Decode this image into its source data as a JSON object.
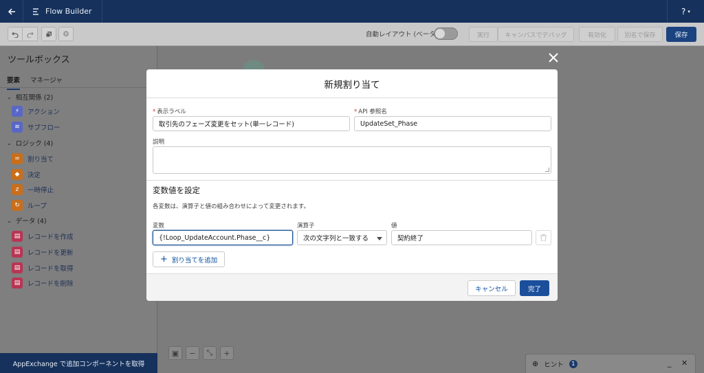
{
  "app": {
    "title": "Flow Builder",
    "help_label": "?"
  },
  "toolbar": {
    "auto_layout_label": "自動レイアウト (ベータ)",
    "auto_layout_on": false,
    "run_label": "実行",
    "debug_label": "キャンバスでデバッグ",
    "activate_label": "有効化",
    "save_as_label": "別名で保存",
    "save_label": "保存"
  },
  "toolbox": {
    "title": "ツールボックス",
    "tabs": [
      {
        "label": "要素"
      },
      {
        "label": "マネージャ"
      }
    ],
    "sections": [
      {
        "label": "相互関係 (2)",
        "items": [
          {
            "label": "アクション",
            "icon": "lightning-icon",
            "color": "#5867c6"
          },
          {
            "label": "サブフロー",
            "icon": "flow-icon",
            "color": "#5867c6"
          }
        ]
      },
      {
        "label": "ロジック (4)",
        "items": [
          {
            "label": "割り当て",
            "icon": "assignment-icon",
            "color": "#c96e1b"
          },
          {
            "label": "決定",
            "icon": "decision-icon",
            "color": "#c96e1b"
          },
          {
            "label": "一時停止",
            "icon": "pause-icon",
            "color": "#c96e1b"
          },
          {
            "label": "ループ",
            "icon": "loop-icon",
            "color": "#c96e1b"
          }
        ]
      },
      {
        "label": "データ (4)",
        "items": [
          {
            "label": "レコードを作成",
            "icon": "record-create-icon",
            "color": "#b83554"
          },
          {
            "label": "レコードを更新",
            "icon": "record-update-icon",
            "color": "#b83554"
          },
          {
            "label": "レコードを取得",
            "icon": "record-lookup-icon",
            "color": "#b83554"
          },
          {
            "label": "レコードを削除",
            "icon": "record-delete-icon",
            "color": "#b83554"
          }
        ]
      }
    ],
    "footer_label": "AppExchange で追加コンポーネントを取得"
  },
  "hint": {
    "label": "ヒント",
    "count": "1"
  },
  "modal": {
    "title": "新規割り当て",
    "label_field": {
      "label": "表示ラベル",
      "value": "取引先のフェーズ変更をセット(単一レコード)"
    },
    "api_field": {
      "label": "API 参照名",
      "value": "UpdateSet_Phase"
    },
    "description_field": {
      "label": "説明",
      "value": ""
    },
    "section_title": "変数値を設定",
    "section_desc": "各変数は、演算子と値の組み合わせによって変更されます。",
    "assignment": {
      "variable_label": "変数",
      "variable_value": "{!Loop_UpdateAccount.Phase__c}",
      "operator_label": "演算子",
      "operator_value": "次の文字列と一致する",
      "value_label": "値",
      "value_value": "契約終了"
    },
    "add_label": "割り当てを追加",
    "cancel_label": "キャンセル",
    "done_label": "完了"
  }
}
